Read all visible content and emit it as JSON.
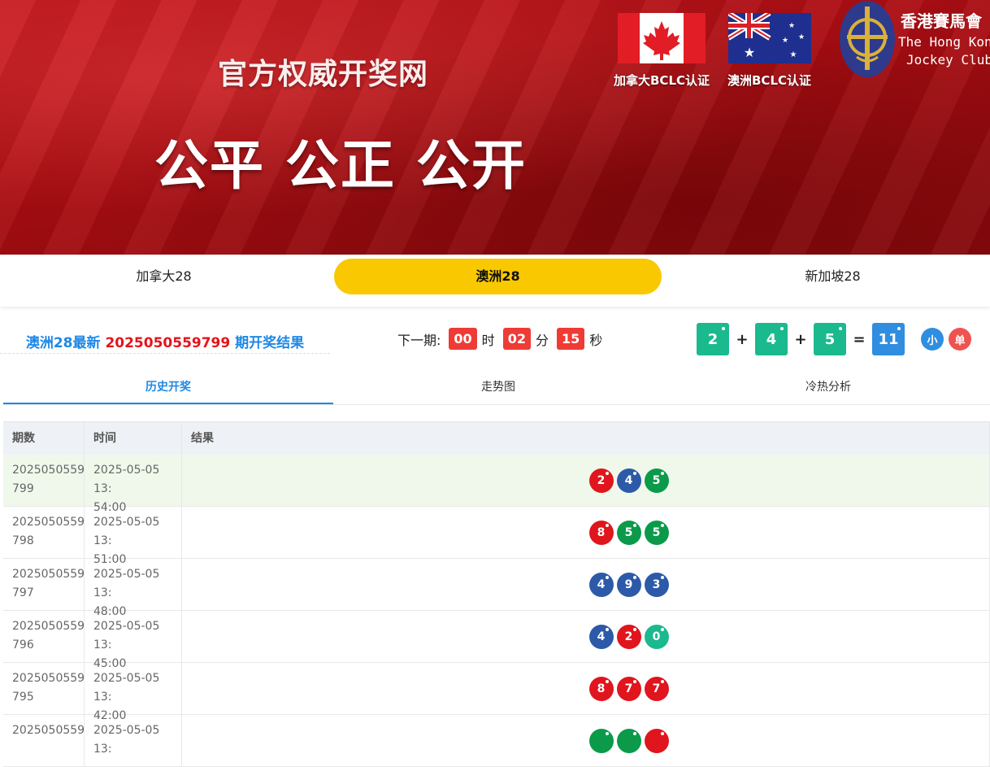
{
  "banner": {
    "subtitle": "官方权威开奖网",
    "slogan": "公平 公正 公开",
    "canada_caption": "加拿大BCLC认证",
    "australia_caption": "澳洲BCLC认证",
    "hkjc_cn": "香港賽馬會",
    "hkjc_en_line1": "The Hong Kong",
    "hkjc_en_line2": "Jockey Club"
  },
  "game_tabs": [
    {
      "label": "加拿大28",
      "active": false
    },
    {
      "label": "澳洲28",
      "active": true
    },
    {
      "label": "新加坡28",
      "active": false
    }
  ],
  "latest": {
    "prefix": "澳洲28最新",
    "issue": "2025050559799",
    "suffix": "期开奖结果"
  },
  "countdown": {
    "label": "下一期:",
    "hours": "00",
    "hours_unit": "时",
    "minutes": "02",
    "minutes_unit": "分",
    "seconds": "15",
    "seconds_unit": "秒"
  },
  "result": {
    "n1": "2",
    "n2": "4",
    "n3": "5",
    "plus": "+",
    "equals": "=",
    "sum": "11",
    "size_tag": "小",
    "parity_tag": "单",
    "colors": {
      "number": "#1bb98e",
      "sum": "#2f8ee0",
      "size": "#2f8ee0",
      "parity": "#ef5350"
    }
  },
  "sub_tabs": [
    {
      "label": "历史开奖",
      "active": true
    },
    {
      "label": "走势图",
      "active": false
    },
    {
      "label": "冷热分析",
      "active": false
    }
  ],
  "table": {
    "headers": [
      "期数",
      "时间",
      "结果"
    ],
    "rows": [
      {
        "issue_a": "2025050559",
        "issue_b": "799",
        "time_a": "2025-05-05 13:",
        "time_b": "54:00",
        "balls": [
          {
            "n": "2",
            "color": "red"
          },
          {
            "n": "4",
            "color": "blue"
          },
          {
            "n": "5",
            "color": "green"
          }
        ]
      },
      {
        "issue_a": "2025050559",
        "issue_b": "798",
        "time_a": "2025-05-05 13:",
        "time_b": "51:00",
        "balls": [
          {
            "n": "8",
            "color": "red"
          },
          {
            "n": "5",
            "color": "green"
          },
          {
            "n": "5",
            "color": "green"
          }
        ]
      },
      {
        "issue_a": "2025050559",
        "issue_b": "797",
        "time_a": "2025-05-05 13:",
        "time_b": "48:00",
        "balls": [
          {
            "n": "4",
            "color": "blue"
          },
          {
            "n": "9",
            "color": "blue"
          },
          {
            "n": "3",
            "color": "blue"
          }
        ]
      },
      {
        "issue_a": "2025050559",
        "issue_b": "796",
        "time_a": "2025-05-05 13:",
        "time_b": "45:00",
        "balls": [
          {
            "n": "4",
            "color": "blue"
          },
          {
            "n": "2",
            "color": "red"
          },
          {
            "n": "0",
            "color": "teal"
          }
        ]
      },
      {
        "issue_a": "2025050559",
        "issue_b": "795",
        "time_a": "2025-05-05 13:",
        "time_b": "42:00",
        "balls": [
          {
            "n": "8",
            "color": "red"
          },
          {
            "n": "7",
            "color": "red"
          },
          {
            "n": "7",
            "color": "red"
          }
        ]
      },
      {
        "issue_a": "2025050559",
        "issue_b": "",
        "time_a": "2025-05-05 13:",
        "time_b": "",
        "balls": [
          {
            "n": "",
            "color": "green"
          },
          {
            "n": "",
            "color": "green"
          },
          {
            "n": "",
            "color": "red"
          }
        ]
      }
    ]
  }
}
